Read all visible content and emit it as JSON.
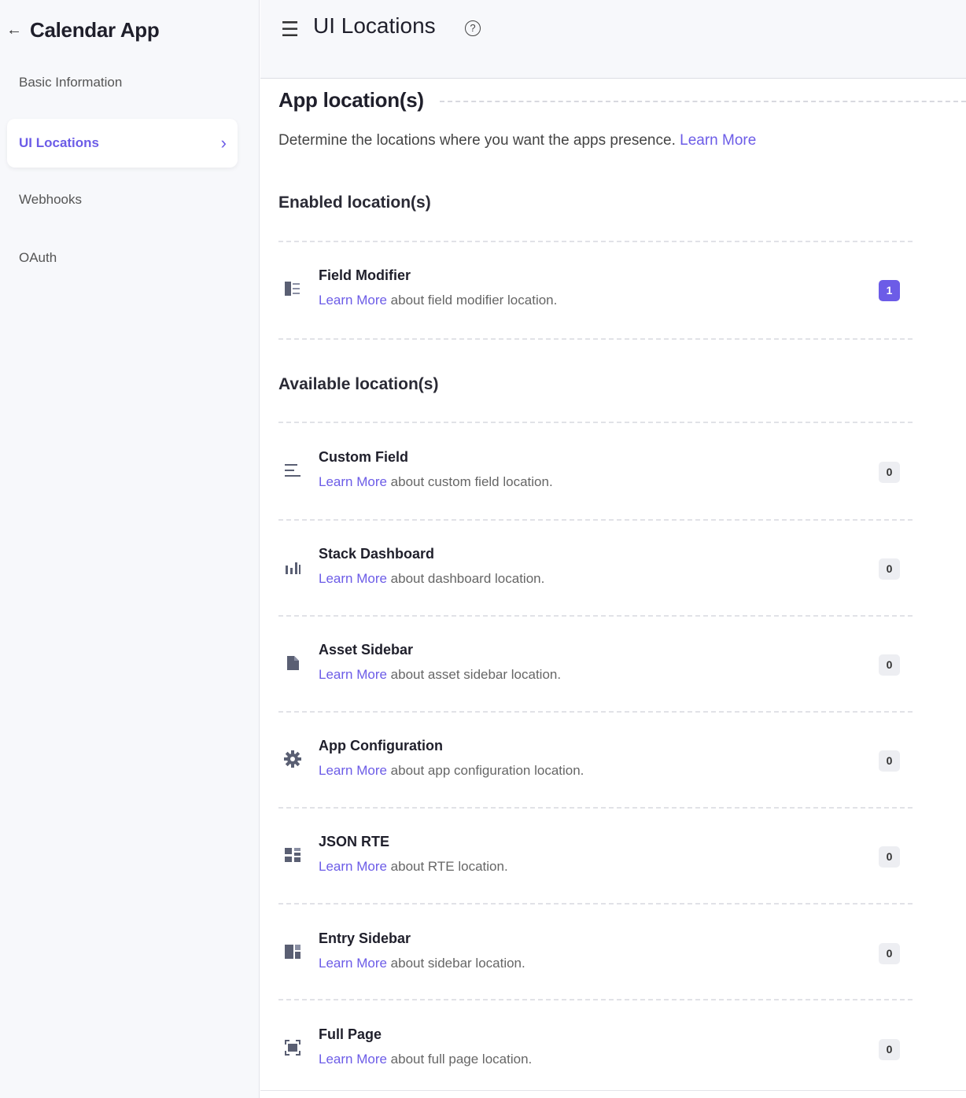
{
  "sidebar": {
    "back_icon": "arrow-left-icon",
    "app_title": "Calendar App",
    "items": [
      {
        "label": "Basic Information"
      },
      {
        "label": "UI Locations",
        "active": true
      },
      {
        "label": "Webhooks"
      },
      {
        "label": "OAuth"
      }
    ]
  },
  "header": {
    "menu_icon": "hamburger-icon",
    "title": "UI Locations",
    "help_icon": "help-circle-icon",
    "help_glyph": "?"
  },
  "main": {
    "section_title": "App location(s)",
    "description": "Determine the locations where you want the apps presence.",
    "description_link": "Learn More",
    "enabled_heading": "Enabled location(s)",
    "available_heading": "Available location(s)",
    "enabled": [
      {
        "name": "Field Modifier",
        "link": "Learn More",
        "desc": "about field modifier location.",
        "count": "1",
        "icon": "field-modifier-icon"
      }
    ],
    "available": [
      {
        "name": "Custom Field",
        "link": "Learn More",
        "desc": "about custom field location.",
        "count": "0",
        "icon": "custom-field-icon"
      },
      {
        "name": "Stack Dashboard",
        "link": "Learn More",
        "desc": "about dashboard location.",
        "count": "0",
        "icon": "dashboard-icon"
      },
      {
        "name": "Asset Sidebar",
        "link": "Learn More",
        "desc": "about asset sidebar location.",
        "count": "0",
        "icon": "asset-icon"
      },
      {
        "name": "App Configuration",
        "link": "Learn More",
        "desc": "about app configuration location.",
        "count": "0",
        "icon": "gear-icon"
      },
      {
        "name": "JSON RTE",
        "link": "Learn More",
        "desc": "about RTE location.",
        "count": "0",
        "icon": "rte-icon"
      },
      {
        "name": "Entry Sidebar",
        "link": "Learn More",
        "desc": "about sidebar location.",
        "count": "0",
        "icon": "sidebar-icon"
      },
      {
        "name": "Full Page",
        "link": "Learn More",
        "desc": "about full page location.",
        "count": "0",
        "icon": "full-page-icon"
      }
    ]
  },
  "colors": {
    "accent": "#6c5ce7",
    "badge_bg": "#edeef2",
    "sidebar_bg": "#f7f8fb"
  }
}
